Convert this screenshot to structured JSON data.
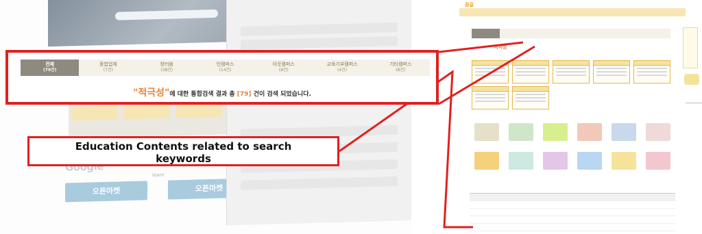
{
  "annotation": {
    "label_line1": "Education Contents related to search",
    "label_line2": "keywords"
  },
  "search_result": {
    "tabs": [
      {
        "label": "전체",
        "count": "(79건)",
        "active": true
      },
      {
        "label": "종합업체",
        "count": "(7건)",
        "active": false
      },
      {
        "label": "창터옴",
        "count": "(38건)",
        "active": false
      },
      {
        "label": "인캠퍼스",
        "count": "(14건)",
        "active": false
      },
      {
        "label": "아웃캠퍼스",
        "count": "(8건)",
        "active": false
      },
      {
        "label": "교육기부캠퍼스",
        "count": "(4건)",
        "active": false
      },
      {
        "label": "기타캠퍼스",
        "count": "(8건)",
        "active": false
      }
    ],
    "keyword_open": "\"",
    "keyword": "적극성",
    "keyword_close": "\"",
    "result_text_before": "에 대한 통합검색 결과 총 ",
    "result_count": "[79]",
    "result_text_after": " 건이 검색 되었습니다."
  },
  "background": {
    "banner_left": "오픈마켓",
    "banner_right": "오픈마켓",
    "google": "Google",
    "learn": "learn"
  },
  "colors": {
    "annotation_red": "#e02020",
    "keyword_orange": "#e8833a",
    "tab_active_bg": "#8e8a80",
    "tab_bg": "#f3f1e8",
    "card_border": "#e5b64a"
  },
  "icons": [
    "search-icon"
  ]
}
